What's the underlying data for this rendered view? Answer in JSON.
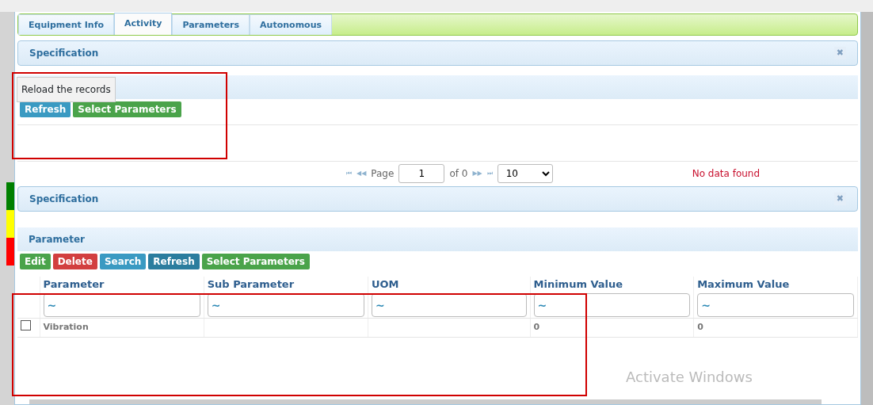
{
  "tabs": [
    {
      "label": "Equipment Info",
      "selected": false
    },
    {
      "label": "Activity",
      "selected": true
    },
    {
      "label": "Parameters",
      "selected": false
    },
    {
      "label": "Autonomous",
      "selected": false
    }
  ],
  "specification_panel": {
    "title": "Specification",
    "close": "✖",
    "tooltip": "Reload the records",
    "toolbar": [
      {
        "label": "Refresh",
        "kind": "info"
      },
      {
        "label": "Select Parameters",
        "kind": "success"
      }
    ],
    "pager": {
      "first": "⏮",
      "prev": "◀◀",
      "page_label": "Page",
      "page": "1",
      "of": "of 0",
      "next": "▶▶",
      "last": "⏭",
      "page_size": "10",
      "message": "No data found"
    }
  },
  "specification_panel_2": {
    "title": "Specification",
    "close": "✖"
  },
  "parameter_grid": {
    "title": "Parameter",
    "toolbar": [
      {
        "label": "Edit",
        "kind": "success"
      },
      {
        "label": "Delete",
        "kind": "danger"
      },
      {
        "label": "Search",
        "kind": "info"
      },
      {
        "label": "Refresh",
        "kind": "dark"
      },
      {
        "label": "Select Parameters",
        "kind": "success"
      }
    ],
    "columns": [
      "Parameter",
      "Sub Parameter",
      "UOM",
      "Minimum Value",
      "Maximum Value"
    ],
    "filters": [
      "~",
      "~",
      "~",
      "~",
      "~"
    ],
    "rows": [
      {
        "checked": false,
        "cells": [
          "Vibration",
          "",
          "",
          "0",
          "0"
        ]
      }
    ]
  },
  "status_strip": [
    {
      "color": "#008000"
    },
    {
      "color": "#ffff00"
    },
    {
      "color": "#ff0000"
    }
  ],
  "os_notice": "Activate Windows"
}
